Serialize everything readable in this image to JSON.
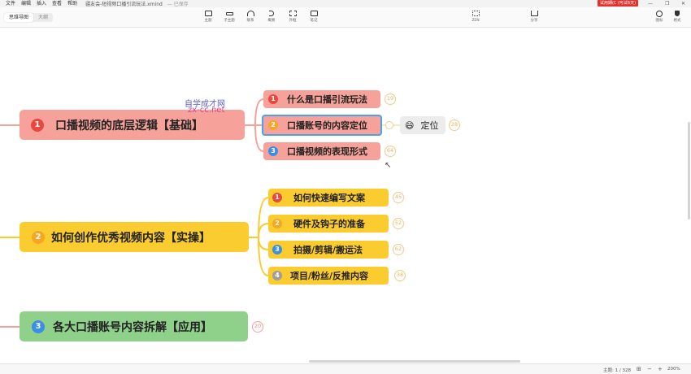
{
  "menubar": {
    "items": [
      "文件",
      "编辑",
      "插入",
      "查看",
      "帮助"
    ],
    "file_name": "疆友会-短视频口播引流玩法.xmind",
    "save_status": "— 已保存",
    "trial_button": "试用期(C (可试6天)",
    "win_controls": [
      "—",
      "❐",
      "✕"
    ]
  },
  "toolbar": {
    "view_tabs": [
      "思维导图",
      "大纲"
    ],
    "tools": [
      {
        "label": "主题",
        "icon": "topic-icon"
      },
      {
        "label": "子主题",
        "icon": "subtopic-icon"
      },
      {
        "label": "联系",
        "icon": "relationship-icon"
      },
      {
        "label": "概要",
        "icon": "summary-icon"
      },
      {
        "label": "外框",
        "icon": "boundary-icon"
      },
      {
        "label": "笔记",
        "icon": "note-icon"
      }
    ],
    "zen_label": "ZEN",
    "share_label": "分享",
    "icon_label": "图标",
    "format_label": "格式"
  },
  "mindmap": {
    "branches": [
      {
        "num": "1",
        "title": "口播视频的底层逻辑【基础】",
        "color": "#f6a29a",
        "num_color": "#e8483f",
        "children": [
          {
            "num": "1",
            "title": "什么是口播引流玩法",
            "count": "19",
            "num_color": "#e8483f"
          },
          {
            "num": "2",
            "title": "口播账号的内容定位",
            "count": "",
            "num_color": "#f5a623"
          },
          {
            "num": "3",
            "title": "口播视频的表现形式",
            "count": "64",
            "num_color": "#3a8ee6"
          }
        ],
        "floating": {
          "emoji": "😄",
          "title": "定位",
          "count": "28"
        }
      },
      {
        "num": "2",
        "title": "如何创作优秀视频内容【实操】",
        "color": "#fbcc2f",
        "num_color": "#f5a623",
        "children": [
          {
            "num": "1",
            "title": "如何快速编写文案",
            "count": "45",
            "num_color": "#e8483f"
          },
          {
            "num": "2",
            "title": "硬件及钩子的准备",
            "count": "52",
            "num_color": "#f5a623"
          },
          {
            "num": "3",
            "title": "拍摄/剪辑/搬运法",
            "count": "62",
            "num_color": "#3a8ee6"
          },
          {
            "num": "4",
            "title": "项目/粉丝/反推内容",
            "count": "38",
            "num_color": "#9e9e9e"
          }
        ]
      },
      {
        "num": "3",
        "title": "各大口播账号内容拆解【应用】",
        "color": "#8fd18b",
        "num_color": "#3a8ee6",
        "count": "20"
      }
    ]
  },
  "watermark": {
    "line1": "自学成才网",
    "line2": "zx-cc.net"
  },
  "statusbar": {
    "topic_count": "主题: 1 / 328",
    "zoom": "200%",
    "zoom_minus": "−",
    "zoom_plus": "+"
  }
}
